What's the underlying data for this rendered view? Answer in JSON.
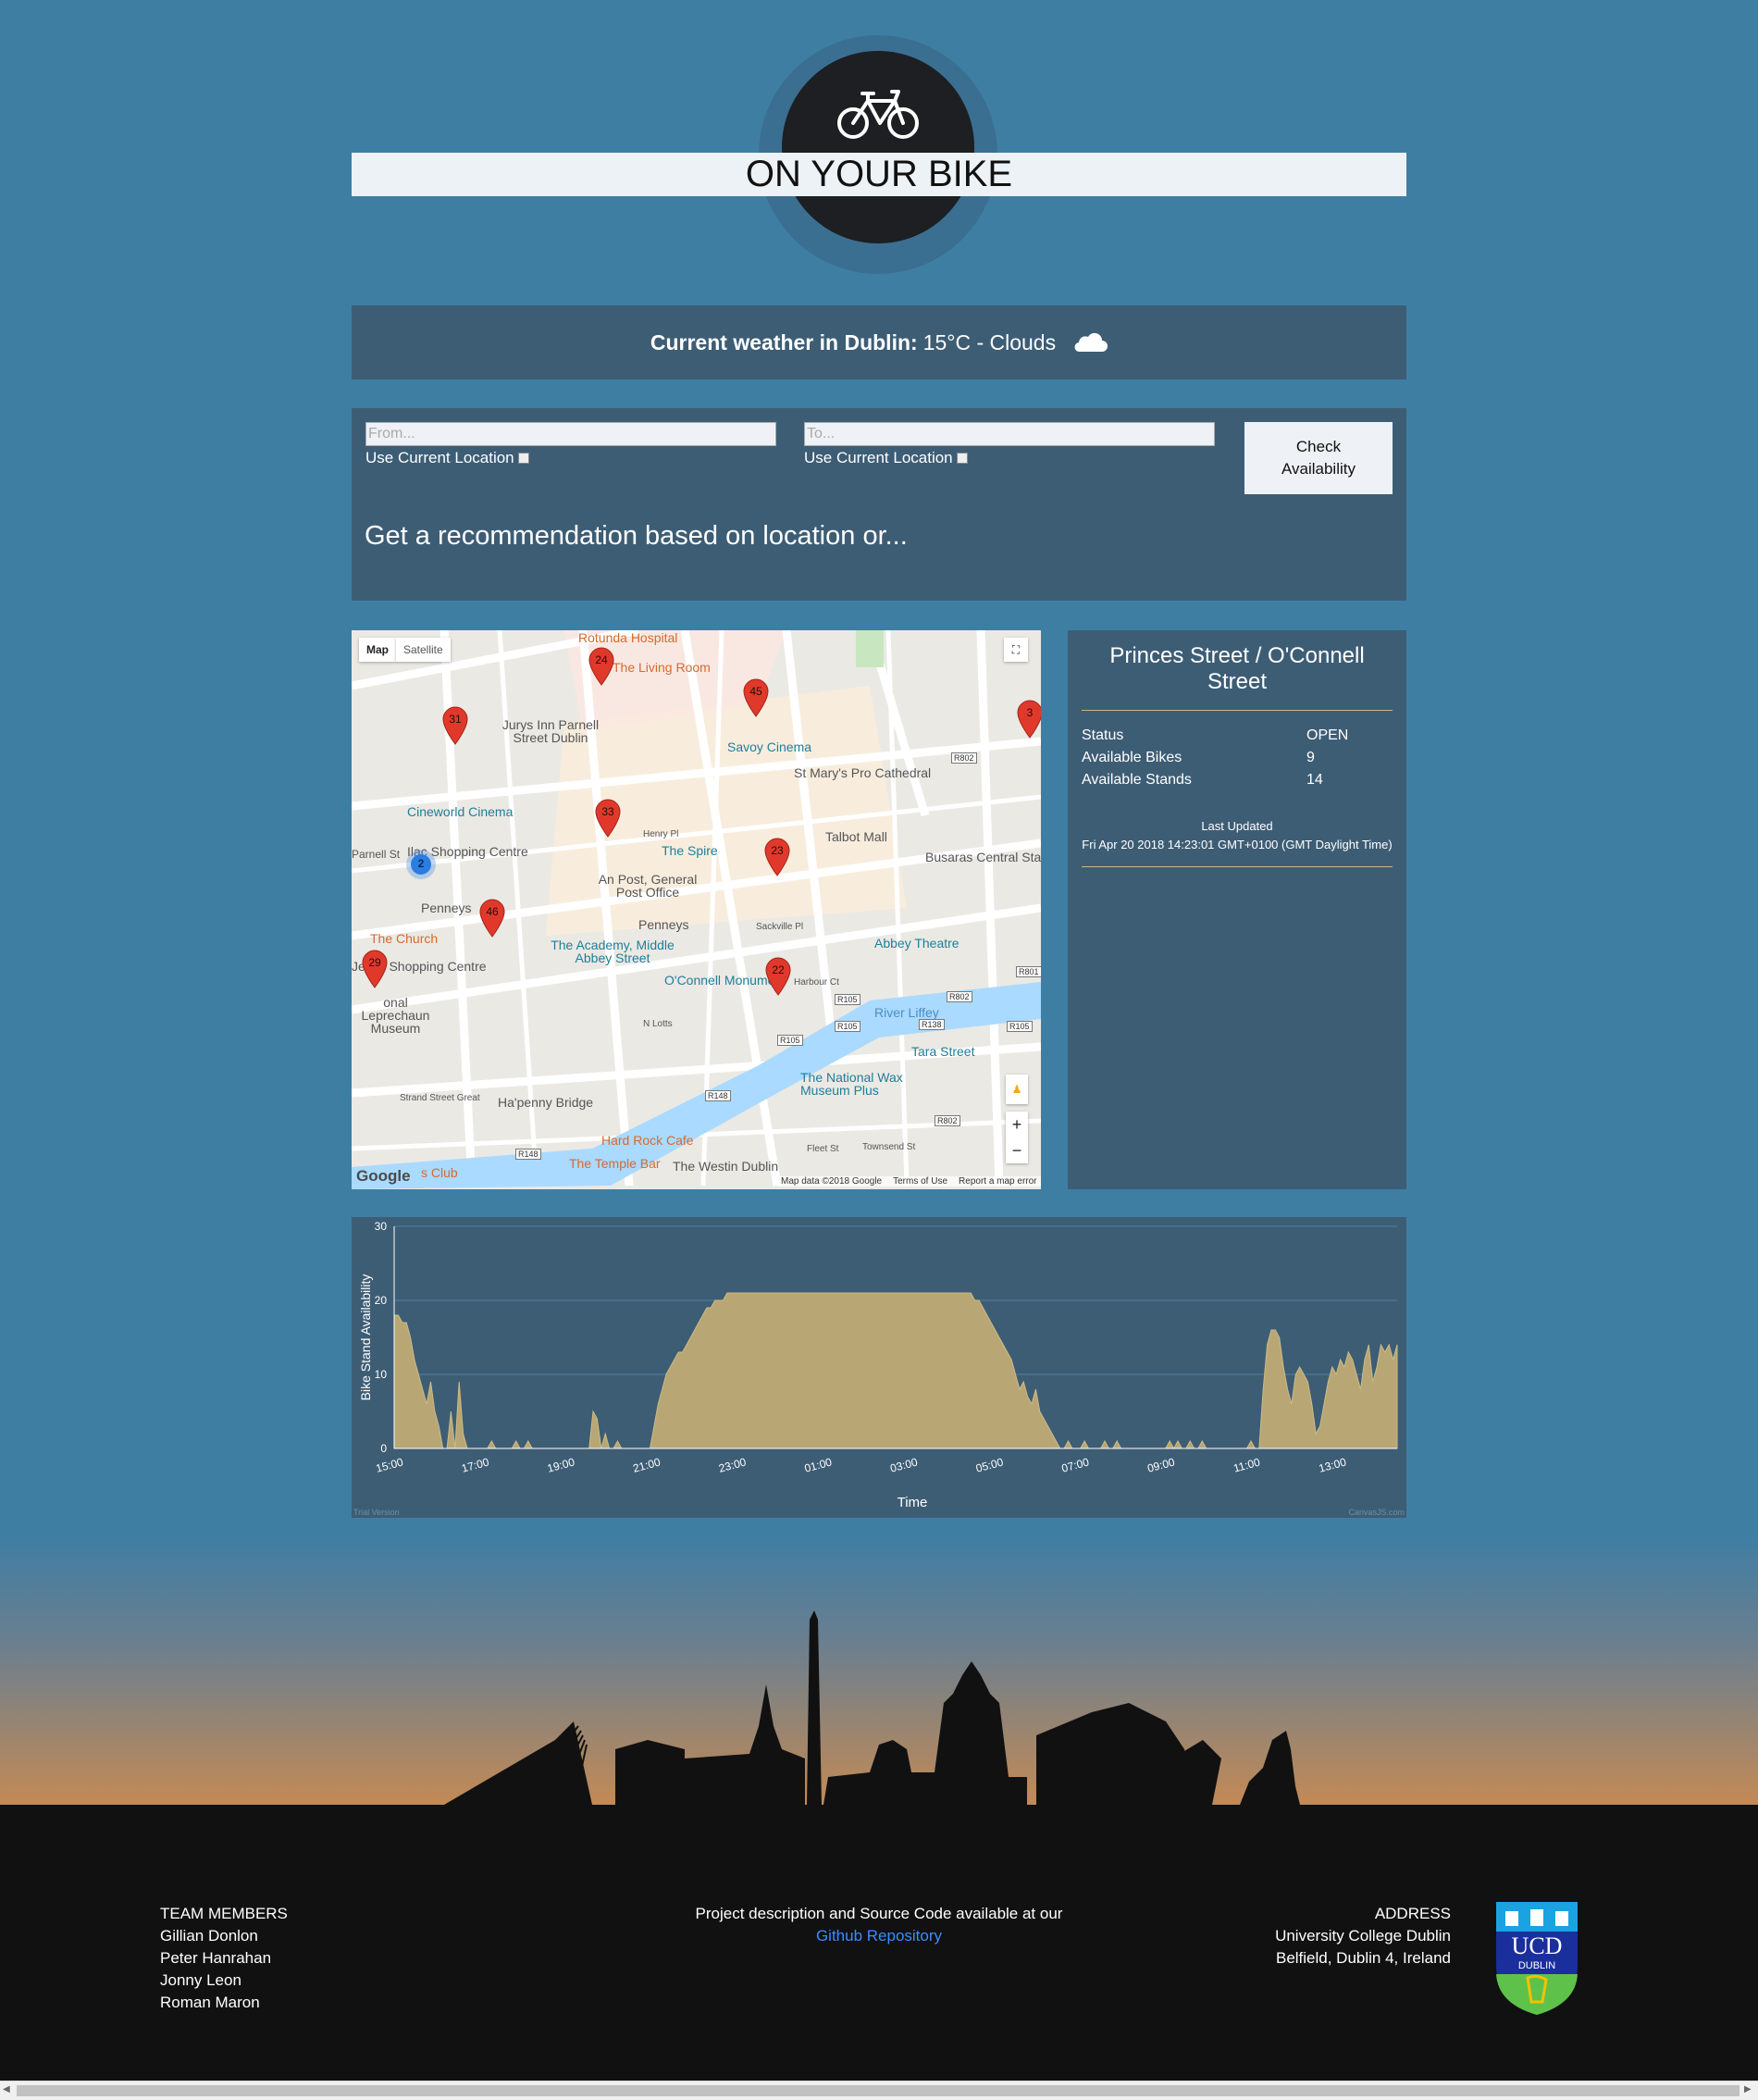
{
  "header": {
    "title": "ON YOUR BIKE"
  },
  "weather": {
    "label": "Current weather in Dublin:",
    "value": "15°C - Clouds"
  },
  "search": {
    "from_placeholder": "From...",
    "to_placeholder": "To...",
    "use_location_from": "Use Current Location",
    "use_location_to": "Use Current Location",
    "button_line1": "Check",
    "button_line2": "Availability",
    "recommendation": "Get a recommendation based on location or..."
  },
  "map": {
    "type_map": "Map",
    "type_satellite": "Satellite",
    "pins": [
      "24",
      "45",
      "31",
      "33",
      "23",
      "46",
      "29",
      "22",
      "2",
      "3"
    ],
    "labels": {
      "rotunda": "Rotunda Hospital",
      "living_room": "The Living Room",
      "jurys": "Jurys Inn Parnell Street Dublin",
      "savoy": "Savoy Cinema",
      "st_marys": "St Mary's Pro Cathedral",
      "cineworld": "Cineworld Cinema",
      "ilac": "Ilac Shopping Centre",
      "spire": "The Spire",
      "talbot": "Talbot Mall",
      "busaras": "Busaras Central Sta",
      "post_office": "An Post, General Post Office",
      "penneys1": "Penneys",
      "penneys2": "Penneys",
      "church": "The Church",
      "academy": "The Academy, Middle Abbey Street",
      "abbey": "Abbey Theatre",
      "jervis": "Jervis Shopping Centre",
      "oconnell": "O'Connell Monument",
      "leprechaun": "onal Leprechaun Museum",
      "liffey": "River Liffey",
      "tara": "Tara Street",
      "wax": "The National Wax Museum Plus",
      "hapenny": "Ha'penny Bridge",
      "hardrock": "Hard Rock Cafe",
      "templebar": "The Temple Bar",
      "westin": "The Westin Dublin",
      "club": "s Club",
      "henry": "Henry Pl",
      "sackville": "Sackville Pl",
      "nlotts": "N Lotts",
      "harbour": "Harbour Ct",
      "fleet": "Fleet St",
      "townsend": "Townsend St",
      "strand": "Strand Street Great",
      "parnell": "Parnell St"
    },
    "road_badges": [
      "R802",
      "R105",
      "R802",
      "R105",
      "R138",
      "R105",
      "R105",
      "R148",
      "R802",
      "R148",
      "R801"
    ],
    "footer_data": "Map data ©2018 Google",
    "footer_terms": "Terms of Use",
    "footer_report": "Report a map error",
    "google": "Google"
  },
  "station": {
    "name": "Princes Street / O'Connell Street",
    "status_label": "Status",
    "status_value": "OPEN",
    "bikes_label": "Available Bikes",
    "bikes_value": "9",
    "stands_label": "Available Stands",
    "stands_value": "14",
    "updated_label": "Last Updated",
    "updated_value": "Fri Apr 20 2018 14:23:01 GMT+0100 (GMT Daylight Time)"
  },
  "chart_data": {
    "type": "area",
    "ylabel": "Bike Stand Availability",
    "xlabel": "Time",
    "ylim": [
      0,
      30
    ],
    "y_ticks": [
      "0",
      "10",
      "20",
      "30"
    ],
    "x_ticks": [
      "15:00",
      "17:00",
      "19:00",
      "21:00",
      "23:00",
      "01:00",
      "03:00",
      "05:00",
      "07:00",
      "09:00",
      "11:00",
      "13:00"
    ],
    "watermark_left": "Trial Version",
    "watermark_right": "CanvasJS.com",
    "fill_color": "#b8a774",
    "values": [
      18,
      18,
      17,
      17,
      15,
      12,
      10,
      8,
      6,
      9,
      5,
      3,
      0,
      0,
      5,
      0,
      9,
      2,
      0,
      0,
      0,
      0,
      0,
      0,
      1,
      0,
      0,
      0,
      0,
      0,
      1,
      0,
      0,
      1,
      0,
      0,
      0,
      0,
      0,
      0,
      0,
      0,
      0,
      0,
      0,
      0,
      0,
      0,
      0,
      5,
      4,
      0,
      2,
      0,
      0,
      1,
      0,
      0,
      0,
      0,
      0,
      0,
      0,
      0,
      3,
      6,
      8,
      10,
      11,
      12,
      13,
      13,
      14,
      15,
      16,
      17,
      18,
      19,
      19,
      20,
      20,
      20,
      21,
      21,
      21,
      21,
      21,
      21,
      21,
      21,
      21,
      21,
      21,
      21,
      21,
      21,
      21,
      21,
      21,
      21,
      21,
      21,
      21,
      21,
      21,
      21,
      21,
      21,
      21,
      21,
      21,
      21,
      21,
      21,
      21,
      21,
      21,
      21,
      21,
      21,
      21,
      21,
      21,
      21,
      21,
      21,
      21,
      21,
      21,
      21,
      21,
      21,
      21,
      21,
      21,
      21,
      21,
      21,
      21,
      21,
      21,
      21,
      21,
      20,
      20,
      19,
      18,
      17,
      16,
      15,
      14,
      13,
      12,
      10,
      8,
      9,
      7,
      6,
      8,
      5,
      4,
      3,
      2,
      1,
      0,
      0,
      1,
      0,
      0,
      0,
      1,
      0,
      0,
      0,
      0,
      1,
      0,
      0,
      1,
      0,
      0,
      0,
      0,
      0,
      0,
      0,
      0,
      0,
      0,
      0,
      0,
      1,
      0,
      1,
      0,
      0,
      1,
      0,
      0,
      1,
      0,
      0,
      0,
      0,
      0,
      0,
      0,
      0,
      0,
      0,
      0,
      1,
      0,
      0,
      8,
      14,
      16,
      16,
      15,
      11,
      8,
      6,
      10,
      11,
      10,
      9,
      6,
      2,
      3,
      6,
      9,
      11,
      10,
      12,
      11,
      13,
      12,
      10,
      8,
      12,
      14,
      9,
      11,
      14,
      13,
      14,
      12,
      14
    ]
  },
  "footer": {
    "team_heading": "TEAM MEMBERS",
    "team": [
      "Gillian Donlon",
      "Peter Hanrahan",
      "Jonny Leon",
      "Roman Maron"
    ],
    "project_text": "Project description and Source Code available at our",
    "repo_link": "Github Repository",
    "address_heading": "ADDRESS",
    "address_line1": "University College Dublin",
    "address_line2": "Belfield, Dublin 4, Ireland",
    "ucd_top": "UCD",
    "ucd_bottom": "DUBLIN"
  },
  "colors": {
    "background": "#3f7ea3",
    "panel": "#3d5d75",
    "accent_gold": "#c7b886",
    "pin_red": "#e0392b",
    "link_blue": "#3d8bff"
  }
}
